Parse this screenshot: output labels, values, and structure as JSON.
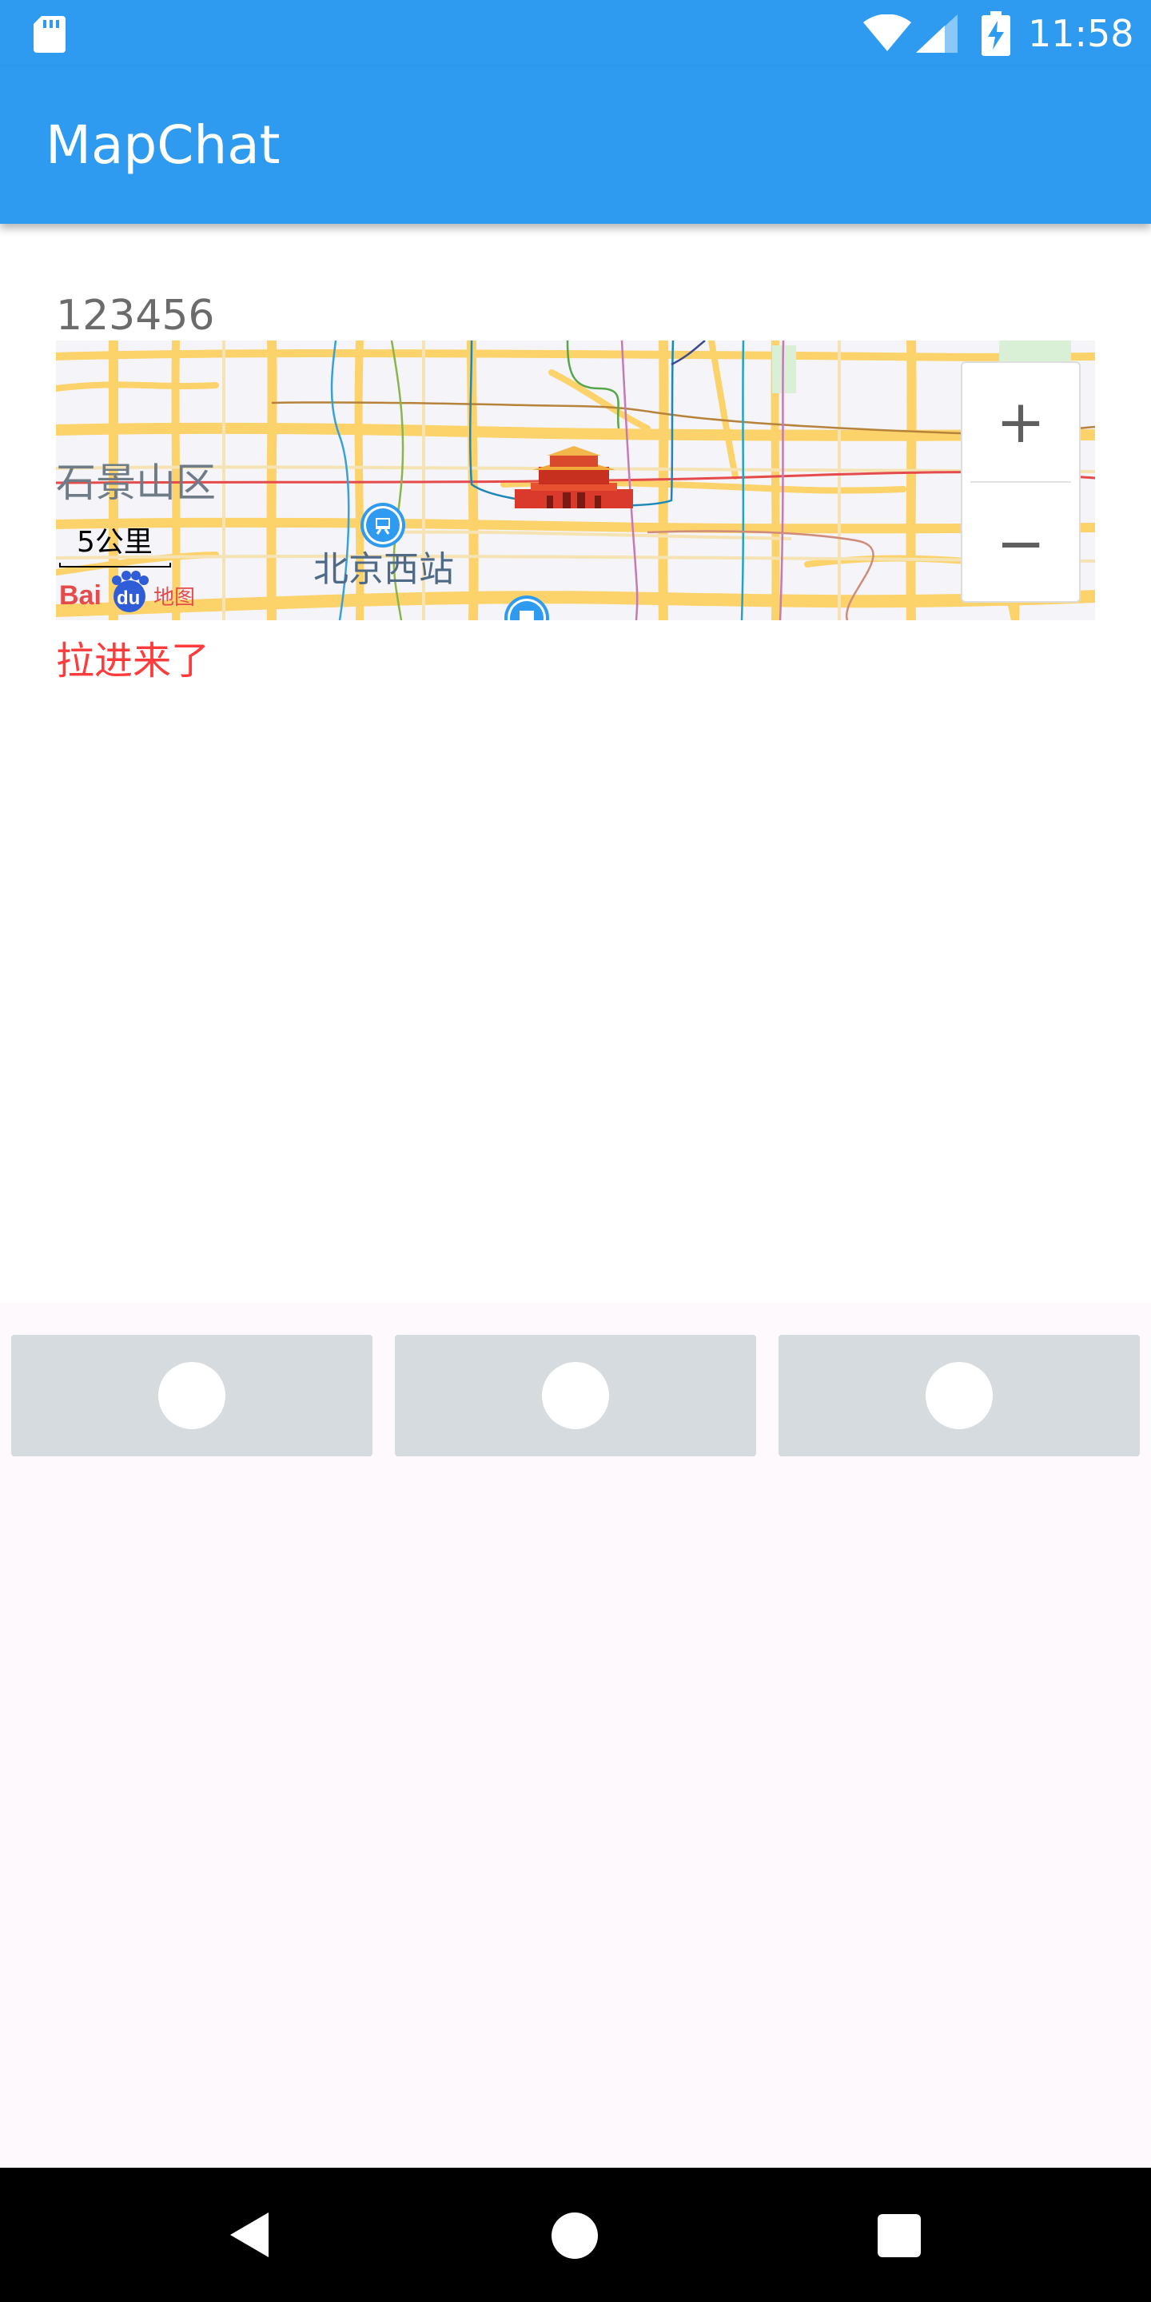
{
  "status_bar": {
    "time": "11:58",
    "icons": [
      "sd-card-icon",
      "wifi-icon",
      "cell-signal-icon",
      "battery-charging-icon"
    ]
  },
  "app_bar": {
    "title": "MapChat"
  },
  "content": {
    "top_text": "123456",
    "map": {
      "district_label": "石景山区",
      "station_label": "北京西站",
      "scale_label": "5公里",
      "logo_text": "Bai du 地图",
      "zoom_in_label": "+",
      "zoom_out_label": "−",
      "colors": {
        "road": "#fcd26a",
        "background": "#f4f4f9",
        "red_line": "#e64b4b"
      }
    },
    "pulled_text": "拉进来了"
  },
  "tabs": [
    {
      "icon": "circle-icon"
    },
    {
      "icon": "circle-icon"
    },
    {
      "icon": "circle-icon"
    }
  ],
  "nav_bar": {
    "icons": [
      "back-icon",
      "home-icon",
      "recents-icon"
    ]
  },
  "colors": {
    "primary": "#2e9bf0",
    "tab_background": "#d6dbdf",
    "accent_text": "#ff3b3b"
  }
}
